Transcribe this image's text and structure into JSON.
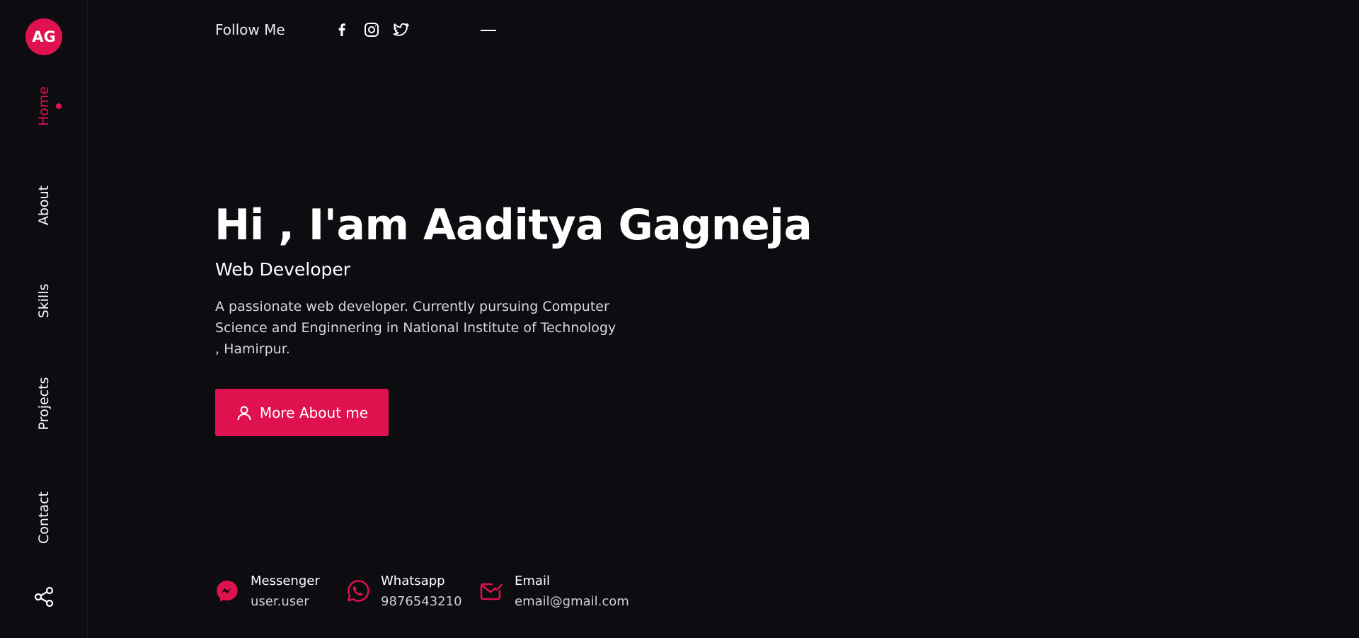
{
  "sidebar": {
    "logo_text": "AG",
    "nav": [
      {
        "label": "Home",
        "active": true
      },
      {
        "label": "About",
        "active": false
      },
      {
        "label": "Skills",
        "active": false
      },
      {
        "label": "Projects",
        "active": false
      },
      {
        "label": "Contact",
        "active": false
      }
    ],
    "share_icon": "share-icon"
  },
  "topbar": {
    "follow_label": "Follow Me",
    "social_icons": [
      "facebook-icon",
      "instagram-icon",
      "twitter-icon"
    ]
  },
  "hero": {
    "title": "Hi , I'am Aaditya Gagneja",
    "subtitle": "Web Developer",
    "description": "A passionate web developer. Currently pursuing Computer Science and Enginnering in National Institute of Technology , Hamirpur.",
    "cta_label": "More About me",
    "cta_icon": "user-icon"
  },
  "contacts": [
    {
      "title": "Messenger",
      "value": "user.user",
      "icon": "messenger-icon"
    },
    {
      "title": "Whatsapp",
      "value": "9876543210",
      "icon": "whatsapp-icon"
    },
    {
      "title": "Email",
      "value": "email@gmail.com",
      "icon": "email-icon"
    }
  ],
  "colors": {
    "accent": "#e0114f",
    "background": "#0c0c11",
    "text": "#ffffff",
    "muted_text": "#d6d6dc"
  }
}
